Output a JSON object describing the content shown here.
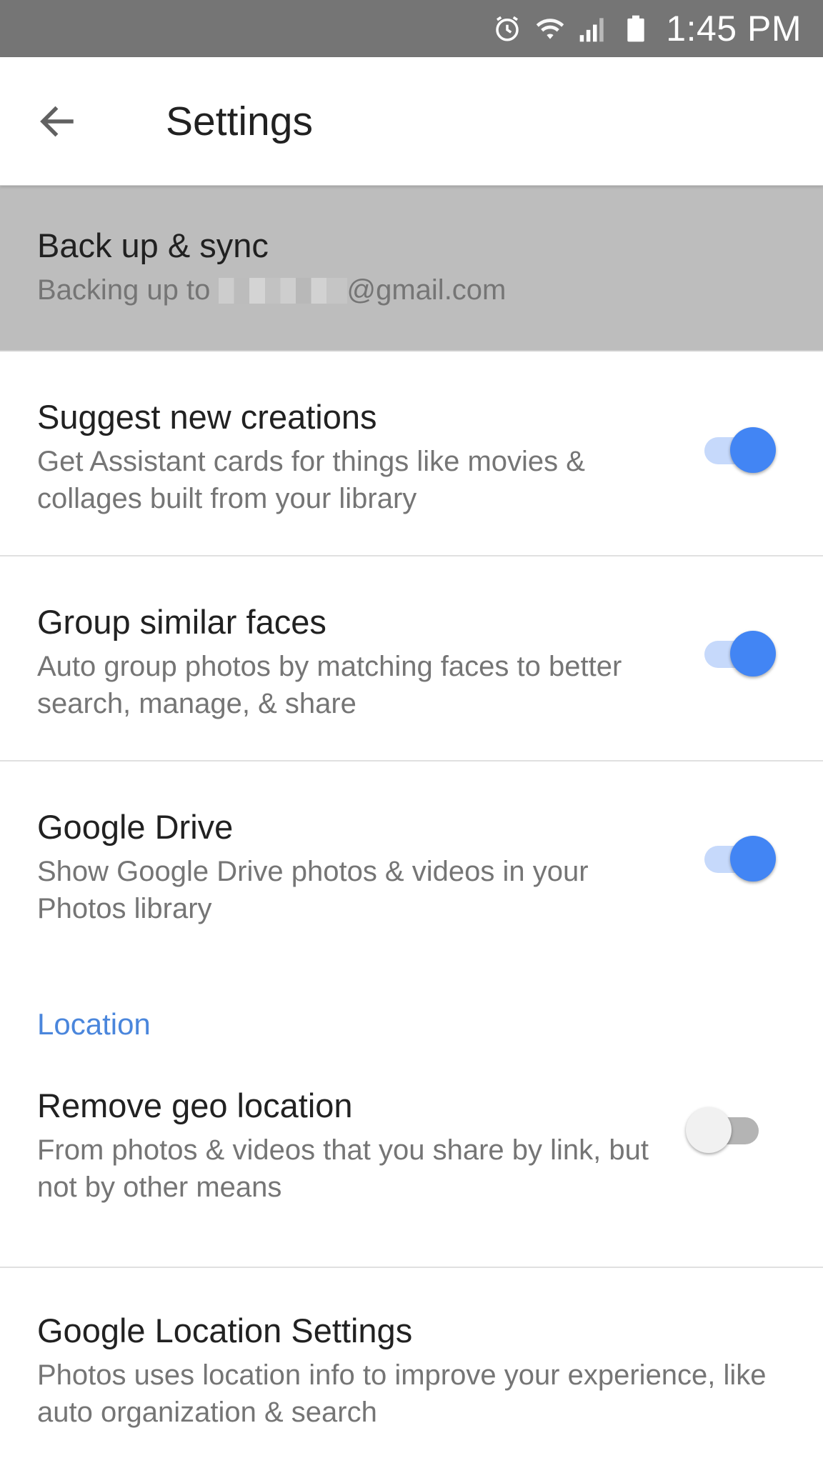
{
  "status_bar": {
    "time": "1:45 PM",
    "icons": [
      "alarm-icon",
      "wifi-icon",
      "signal-icon",
      "battery-icon"
    ]
  },
  "app_bar": {
    "title": "Settings",
    "back_icon": "arrow-back-icon"
  },
  "settings": [
    {
      "title": "Back up & sync",
      "subtitle_prefix": "Backing up to ",
      "subtitle_suffix": "@gmail.com"
    },
    {
      "title": "Suggest new creations",
      "subtitle": "Get Assistant cards for things like movies & collages built from your library",
      "toggle": "on"
    },
    {
      "title": "Group similar faces",
      "subtitle": "Auto group photos by matching faces to better search, manage, & share",
      "toggle": "on"
    },
    {
      "title": "Google Drive",
      "subtitle": "Show Google Drive photos & videos in your Photos library",
      "toggle": "on"
    }
  ],
  "location_section": {
    "header": "Location",
    "items": [
      {
        "title": "Remove geo location",
        "subtitle": "From photos & videos that you share by link, but not by other means",
        "toggle": "off"
      },
      {
        "title": "Google Location Settings",
        "subtitle": "Photos uses location info to improve your experience, like auto organization & search"
      }
    ]
  },
  "colors": {
    "status_bar": "#757575",
    "highlight_row": "#bdbdbd",
    "accent": "#4285f4",
    "section_header": "#4a86dc"
  }
}
